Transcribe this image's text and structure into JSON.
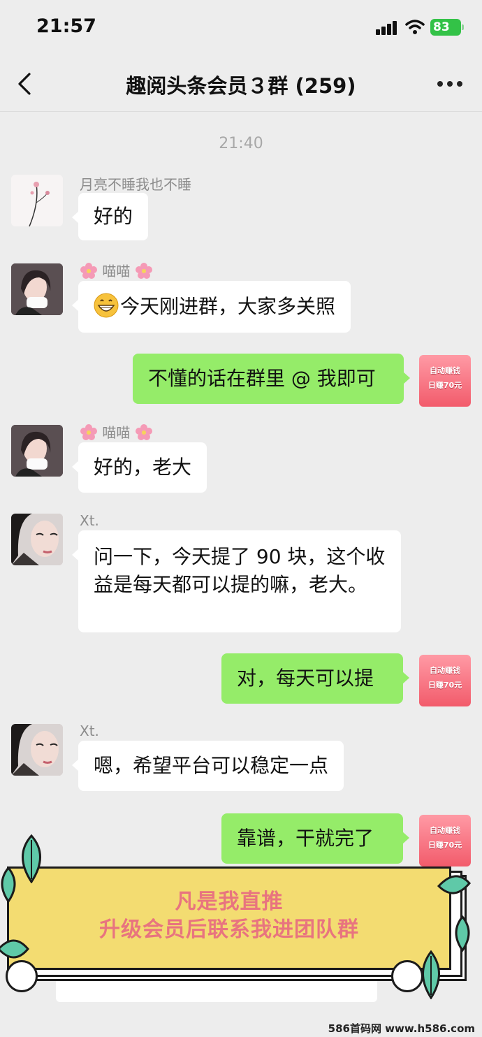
{
  "status_bar": {
    "time": "21:57",
    "battery": "83"
  },
  "header": {
    "title": "趣阅头条会员３群 (259)"
  },
  "timestamp": "21:40",
  "messages": [
    {
      "sender": "月亮不睡我也不睡",
      "text": "好的"
    },
    {
      "sender": "喵喵",
      "text": "今天刚进群，大家多关照"
    },
    {
      "text": "不懂的话在群里 @ 我即可"
    },
    {
      "sender": "喵喵",
      "text": "好的，老大"
    },
    {
      "sender": "Xt.",
      "text": "问一下，今天提了 90 块，这个收益是每天都可以提的嘛，老大。"
    },
    {
      "text": "对，每天可以提"
    },
    {
      "sender": "Xt.",
      "text": "嗯，希望平台可以稳定一点"
    },
    {
      "text": "靠谱，干就完了"
    }
  ],
  "self_avatar": {
    "line1": "自动赚钱",
    "line2": "日赚70元"
  },
  "banner": {
    "line1": "凡是我直推",
    "line2": "升级会员后联系我进团队群"
  },
  "watermark": "586首码网 www.h586.com",
  "colors": {
    "bubble_green": "#95ec69",
    "banner_yellow": "#f3dc71",
    "banner_text": "#e8747f"
  }
}
